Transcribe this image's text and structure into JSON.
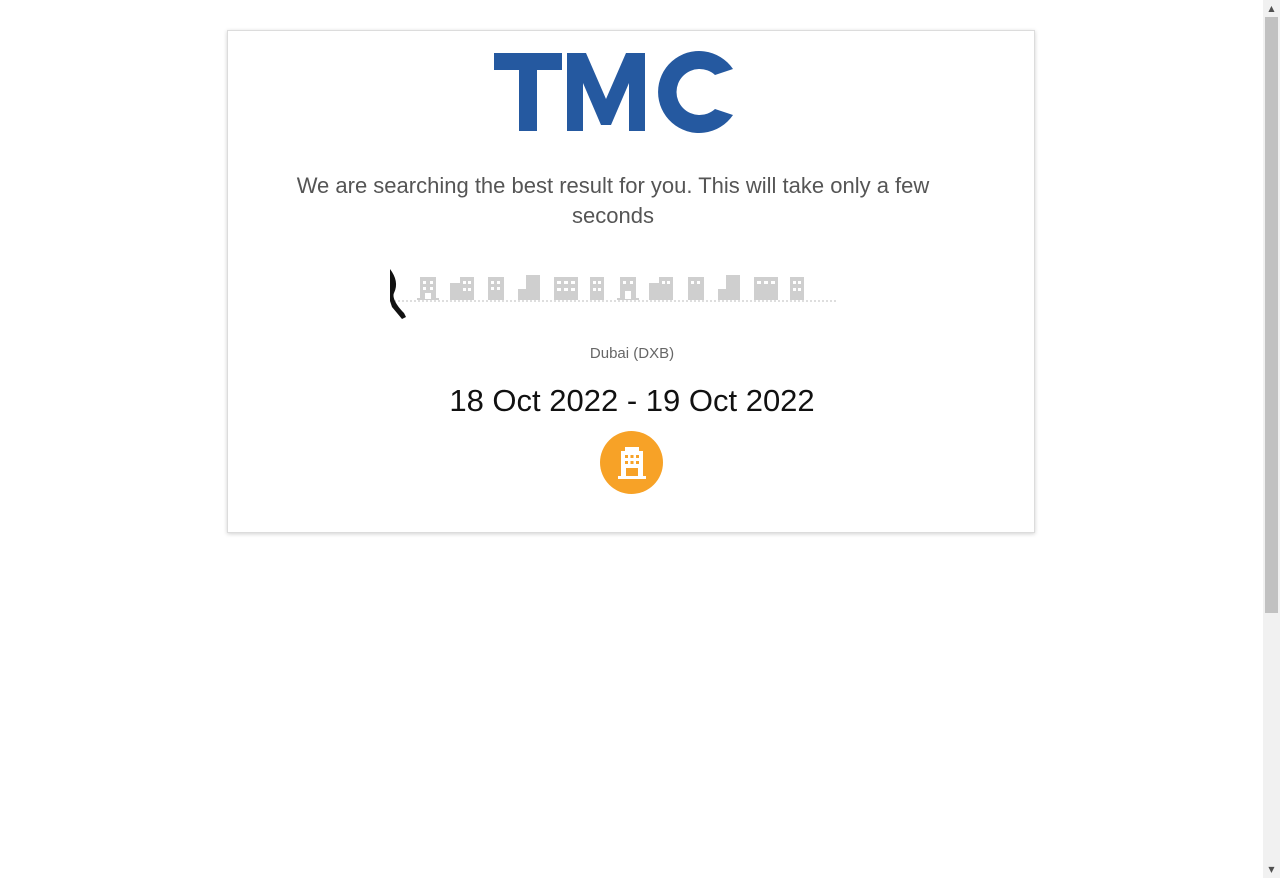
{
  "brand": {
    "logo_text": "TMC",
    "color": "#2559a0"
  },
  "loader": {
    "message": "We are searching the best result for you. This will take only a few seconds",
    "destination": "Dubai (DXB)",
    "dates": "18 Oct 2022 - 19 Oct 2022",
    "icons": {
      "skyline": "city-buildings-icon",
      "animation": "walking-figure-icon",
      "badge": "hotel-building-icon"
    },
    "accent_color": "#f7a227"
  },
  "scrollbar": {
    "up_arrow": "▲",
    "down_arrow": "▼"
  }
}
